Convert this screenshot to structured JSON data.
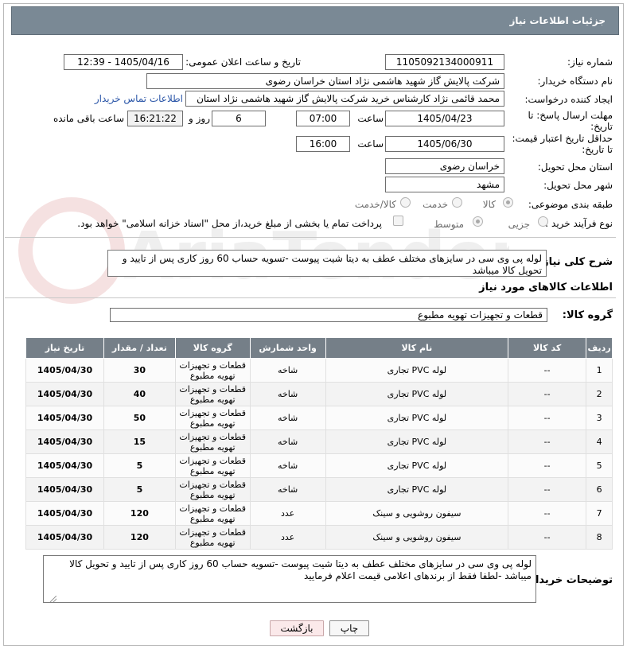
{
  "header": {
    "title": "جزئیات اطلاعات نیاز"
  },
  "form": {
    "need_number": {
      "label": "شماره نیاز:",
      "value": "1105092134000911"
    },
    "announce_datetime": {
      "label": "تاریخ و ساعت اعلان عمومی:",
      "value": "1405/04/16 - 12:39"
    },
    "buyer_org": {
      "label": "نام دستگاه خریدار:",
      "value": "شرکت پالایش گاز شهید هاشمی نژاد   استان خراسان رضوی"
    },
    "requester": {
      "label": "ایجاد کننده درخواست:",
      "value": "محمد قائمی نژاد کارشناس خرید  شرکت پالایش گاز شهید هاشمی نژاد   استان",
      "contact_link": "اطلاعات تماس خریدار"
    },
    "reply_deadline": {
      "label_line1": "مهلت ارسال پاسخ: تا",
      "label_line2": "تاریخ:",
      "date": "1405/04/23",
      "time_label": "ساعت",
      "time": "07:00",
      "days": "6",
      "days_label": "روز و",
      "remaining": "16:21:22",
      "remaining_label": "ساعت باقی مانده"
    },
    "price_validity": {
      "label_line1": "حداقل تاریخ اعتبار قیمت:",
      "label_line2": "تا تاریخ:",
      "date": "1405/06/30",
      "time_label": "ساعت",
      "time": "16:00"
    },
    "delivery_province": {
      "label": "استان محل تحویل:",
      "value": "خراسان رضوی"
    },
    "delivery_city": {
      "label": "شهر محل تحویل:",
      "value": "مشهد"
    },
    "category": {
      "label": "طبقه بندی موضوعی:",
      "options": [
        "کالا",
        "خدمت",
        "کالا/خدمت"
      ],
      "selected": "کالا"
    },
    "process_type": {
      "label": "نوع فرآیند خرید :",
      "options": [
        "جزیی",
        "متوسط"
      ],
      "selected": "متوسط",
      "payment_note": "پرداخت تمام یا بخشی از مبلغ خرید،از محل \"اسناد خزانه اسلامی\" خواهد بود."
    }
  },
  "summary": {
    "label": "شرح کلی نیاز:",
    "text": "لوله پی وی سی در سایزهای مختلف عطف به دیتا شیت پیوست -تسویه حساب 60 روز کاری پس از تایید و تحویل کالا میباشد"
  },
  "goods_section": {
    "title": "اطلاعات کالاهای مورد نیاز",
    "group_label": "گروه کالا:",
    "group_value": "قطعات و تجهیزات تهویه مطبوع"
  },
  "table": {
    "headers": [
      "ردیف",
      "کد کالا",
      "نام کالا",
      "واحد شمارش",
      "گروه کالا",
      "تعداد / مقدار",
      "تاریخ نیاز"
    ],
    "rows": [
      [
        "1",
        "--",
        "لوله PVC تجاری",
        "شاخه",
        "قطعات و تجهیزات تهویه مطبوع",
        "30",
        "1405/04/30"
      ],
      [
        "2",
        "--",
        "لوله PVC تجاری",
        "شاخه",
        "قطعات و تجهیزات تهویه مطبوع",
        "40",
        "1405/04/30"
      ],
      [
        "3",
        "--",
        "لوله PVC تجاری",
        "شاخه",
        "قطعات و تجهیزات تهویه مطبوع",
        "50",
        "1405/04/30"
      ],
      [
        "4",
        "--",
        "لوله PVC تجاری",
        "شاخه",
        "قطعات و تجهیزات تهویه مطبوع",
        "15",
        "1405/04/30"
      ],
      [
        "5",
        "--",
        "لوله PVC تجاری",
        "شاخه",
        "قطعات و تجهیزات تهویه مطبوع",
        "5",
        "1405/04/30"
      ],
      [
        "6",
        "--",
        "لوله PVC تجاری",
        "شاخه",
        "قطعات و تجهیزات تهویه مطبوع",
        "5",
        "1405/04/30"
      ],
      [
        "7",
        "--",
        "سیفون روشویی و سینک",
        "عدد",
        "قطعات و تجهیزات تهویه مطبوع",
        "120",
        "1405/04/30"
      ],
      [
        "8",
        "--",
        "سیفون روشویی و سینک",
        "عدد",
        "قطعات و تجهیزات تهویه مطبوع",
        "120",
        "1405/04/30"
      ]
    ]
  },
  "buyer_notes": {
    "label": "توضیحات خریدار:",
    "text": "لوله پی وی سی در سایزهای مختلف عطف به دیتا شیت پیوست -تسویه حساب 60 روز کاری پس از تایید و تحویل کالا میباشد -لطفا فقط از برندهای اعلامی قیمت اعلام فرمایید"
  },
  "buttons": {
    "print": "چاپ",
    "back": "بازگشت"
  },
  "watermark": {
    "text": "AriaTender.net"
  },
  "colors": {
    "titlebar": "#7a8995",
    "table_header": "#757f88",
    "link": "#2b56a8"
  }
}
